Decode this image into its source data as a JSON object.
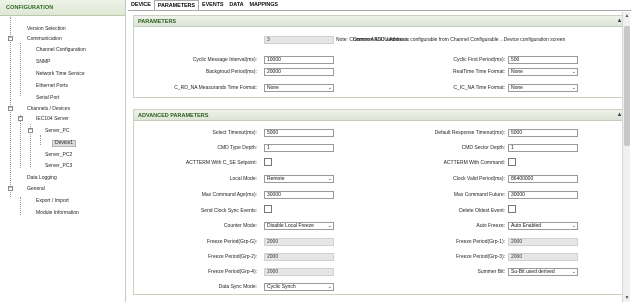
{
  "sidebar": {
    "title": "CONFIGURATION",
    "items": [
      {
        "label": "Version Selection"
      },
      {
        "label": "Communication"
      },
      {
        "label": "Channel Configuration"
      },
      {
        "label": "SNMP"
      },
      {
        "label": "Network Time Service"
      },
      {
        "label": "Ethernet Ports"
      },
      {
        "label": "Serial Port"
      },
      {
        "label": "Channels / Devices"
      },
      {
        "label": "IEC104 Server"
      },
      {
        "label": "Server_PC"
      },
      {
        "label": "Device1"
      },
      {
        "label": "Server_PC2"
      },
      {
        "label": "Server_PC3"
      },
      {
        "label": "Data Logging"
      },
      {
        "label": "General"
      },
      {
        "label": "Export / Import"
      },
      {
        "label": "Module Information"
      }
    ]
  },
  "tabs": [
    "DEVICE",
    "PARAMETERS",
    "EVENTS",
    "DATA",
    "MAPPINGS"
  ],
  "active_tab": "PARAMETERS",
  "parameters": {
    "title": "PARAMETERS",
    "common_asdu_label": "Common ASDU Address:",
    "common_asdu_value": "3",
    "common_asdu_note": "Note: Common ASDU address is configurable from Channel Configurable→Device configuration screen",
    "cyclic_interval_label": "Cyclic Message Interval(ms):",
    "cyclic_interval_value": "10000",
    "cyclic_first_label": "Cyclic First Period(ms):",
    "cyclic_first_value": "500",
    "background_label": "Backgroud Period(ms):",
    "background_value": "20000",
    "realtime_label": "RealTime Time Format:",
    "realtime_value": "None",
    "crd_label": "C_RD_NA Measurands Time Format:",
    "crd_value": "None",
    "cic_label": "C_IC_NA Time Format:",
    "cic_value": "None"
  },
  "advanced": {
    "title": "ADVANCED PARAMETERS",
    "select_timeout_label": "Select Timeout(ms):",
    "select_timeout_value": "5000",
    "default_response_label": "Default Response Timeout(ms):",
    "default_response_value": "5000",
    "cmd_type_label": "CMD Type Depth:",
    "cmd_type_value": "1",
    "cmd_sector_label": "CMD Sector Depth:",
    "cmd_sector_value": "1",
    "actterm_setpoint_label": "ACTTERM With C_SE Setpoint:",
    "actterm_command_label": "ACTTERM With Command:",
    "local_mode_label": "Local Mode:",
    "local_mode_value": "Remote",
    "clock_valid_label": "Clock Valid Period(ms):",
    "clock_valid_value": "86400000",
    "max_cmd_age_label": "Max Command Age(ms):",
    "max_cmd_age_value": "30000",
    "max_cmd_future_label": "Max Command Future:",
    "max_cmd_future_value": "30000",
    "send_clock_label": "Send Clock Sync Events:",
    "delete_oldest_label": "Delete Oldest Event:",
    "counter_mode_label": "Counter Mode:",
    "counter_mode_value": "Disable Local Freeze",
    "auto_freeze_label": "Auto Freeze:",
    "auto_freeze_value": "Auto Enabled",
    "freeze_g_label": "Freeze Period(Grp-G):",
    "freeze_g_value": "2000",
    "freeze_1_label": "Freeze Period(Grp-1):",
    "freeze_1_value": "2000",
    "freeze_2_label": "Freeze Period(Grp-2):",
    "freeze_2_value": "2000",
    "freeze_3_label": "Freeze Period(Grp-3):",
    "freeze_3_value": "2000",
    "freeze_4_label": "Freeze Period(Grp-4):",
    "freeze_4_value": "2000",
    "summer_bit_label": "Summer Bit:",
    "summer_bit_value": "Su-Bit used derived",
    "data_sync_label": "Data Sync Mode:",
    "data_sync_value": "Cyclic Synch"
  }
}
